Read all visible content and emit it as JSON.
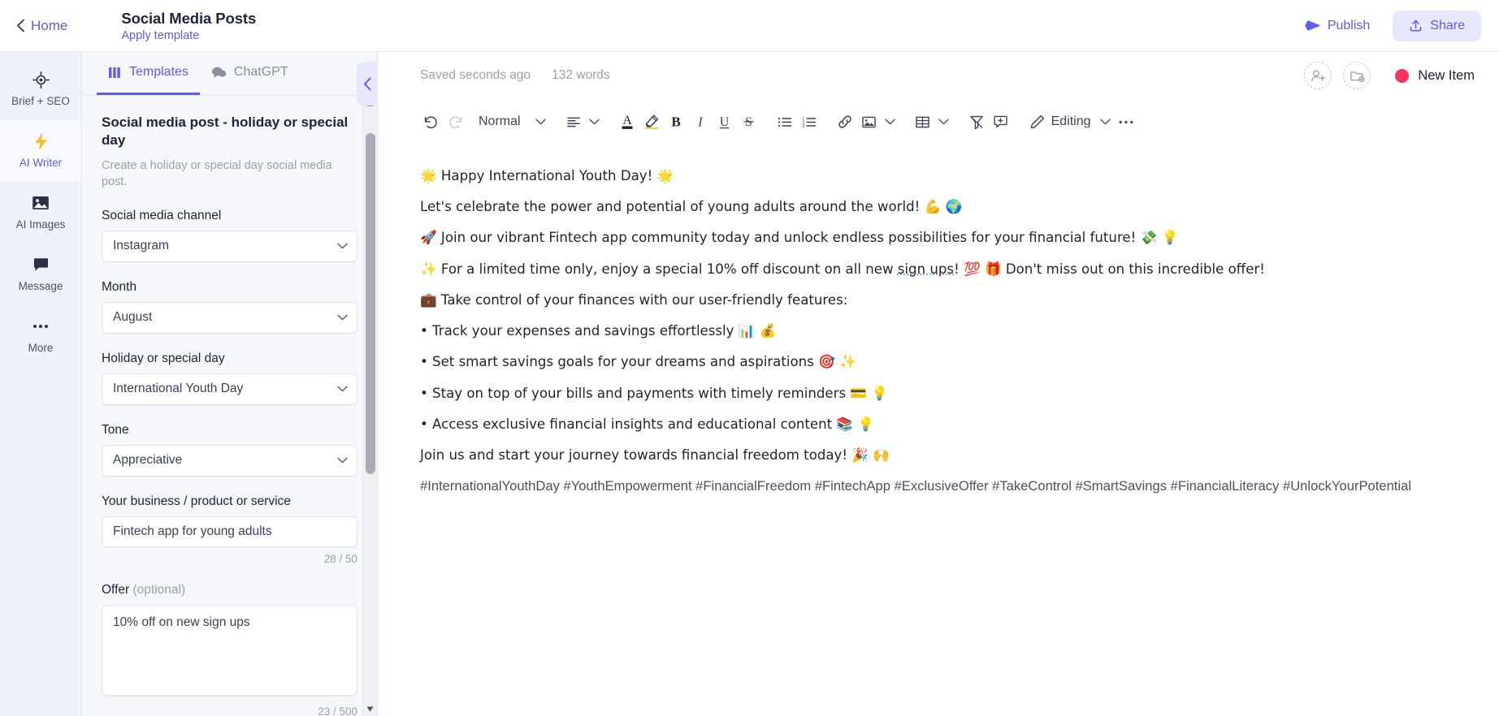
{
  "header": {
    "home_label": "Home",
    "doc_title": "Social Media Posts",
    "apply_template_label": "Apply template",
    "publish_label": "Publish",
    "share_label": "Share",
    "accent_color": "#5b5fe8"
  },
  "rail": {
    "items": [
      {
        "label": "Brief + SEO",
        "icon": "target-icon",
        "active": false
      },
      {
        "label": "AI Writer",
        "icon": "lightning-bolt-icon",
        "active": true
      },
      {
        "label": "AI Images",
        "icon": "image-icon",
        "active": false
      },
      {
        "label": "Message",
        "icon": "speech-bubble-icon",
        "active": false
      },
      {
        "label": "More",
        "icon": "ellipsis-icon",
        "active": false
      }
    ]
  },
  "panel": {
    "tabs": [
      {
        "label": "Templates",
        "icon": "templates-grid-icon",
        "active": true
      },
      {
        "label": "ChatGPT",
        "icon": "chat-bubbles-icon",
        "active": false
      }
    ],
    "template_name": "Social media post - holiday or special day",
    "template_description": "Create a holiday or special day social media post.",
    "fields": {
      "channel_label": "Social media channel",
      "channel_value": "Instagram",
      "month_label": "Month",
      "month_value": "August",
      "holiday_label": "Holiday or special day",
      "holiday_value": "International Youth Day",
      "tone_label": "Tone",
      "tone_value": "Appreciative",
      "business_label": "Your business / product or service",
      "business_value": "Fintech app for young adults",
      "business_counter": "28 / 50",
      "offer_label": "Offer",
      "offer_label_optional": "(optional)",
      "offer_value": "10% off on new sign ups",
      "offer_counter": "23 / 500"
    }
  },
  "editor": {
    "saved_status": "Saved seconds ago",
    "word_count": "132 words",
    "new_item_label": "New Item",
    "new_item_color": "#f6335e",
    "toolbar": {
      "undo": "undo-icon",
      "redo": "redo-icon",
      "style": "Normal",
      "align": "align-left-icon",
      "text_color": "A",
      "highlight": "highlighter-icon",
      "bold": "B",
      "italic": "I",
      "underline": "U",
      "strikethrough": "S",
      "bullet_list": "bullet-list-icon",
      "numbered_list": "numbered-list-icon",
      "link": "link-icon",
      "image": "image-icon",
      "table": "table-icon",
      "clear_format": "clear-formatting-icon",
      "comment": "add-comment-icon",
      "editing_mode": "Editing",
      "more": "more-options-icon"
    },
    "document": {
      "lines": [
        {
          "text": "🌟 Happy International Youth Day! 🌟",
          "type": "paragraph"
        },
        {
          "text": "Let's celebrate the power and potential of young adults around the world! 💪 🌍",
          "type": "paragraph"
        },
        {
          "text": "🚀 Join our vibrant Fintech app community today and unlock endless possibilities for your financial future! 💸 💡",
          "type": "paragraph"
        },
        {
          "text": "✨ For a limited time only, enjoy a special 10% off discount on all new sign ups! 💯 🎁 Don't miss out on this incredible offer!",
          "type": "paragraph",
          "spellcheck_word": "sign ups"
        },
        {
          "text": "💼 Take control of your finances with our user-friendly features:",
          "type": "paragraph"
        },
        {
          "text": "• Track your expenses and savings effortlessly 📊 💰",
          "type": "bullet"
        },
        {
          "text": "• Set smart savings goals for your dreams and aspirations 🎯 ✨",
          "type": "bullet"
        },
        {
          "text": "• Stay on top of your bills and payments with timely reminders 💳 💡",
          "type": "bullet"
        },
        {
          "text": "• Access exclusive financial insights and educational content 📚 💡",
          "type": "bullet"
        },
        {
          "text": "Join us and start your journey towards financial freedom today! 🎉 🙌",
          "type": "paragraph"
        },
        {
          "text": "#InternationalYouthDay #YouthEmpowerment #FinancialFreedom #FintechApp #ExclusiveOffer #TakeControl #SmartSavings #FinancialLiteracy #UnlockYourPotential",
          "type": "hashtags"
        }
      ]
    }
  }
}
